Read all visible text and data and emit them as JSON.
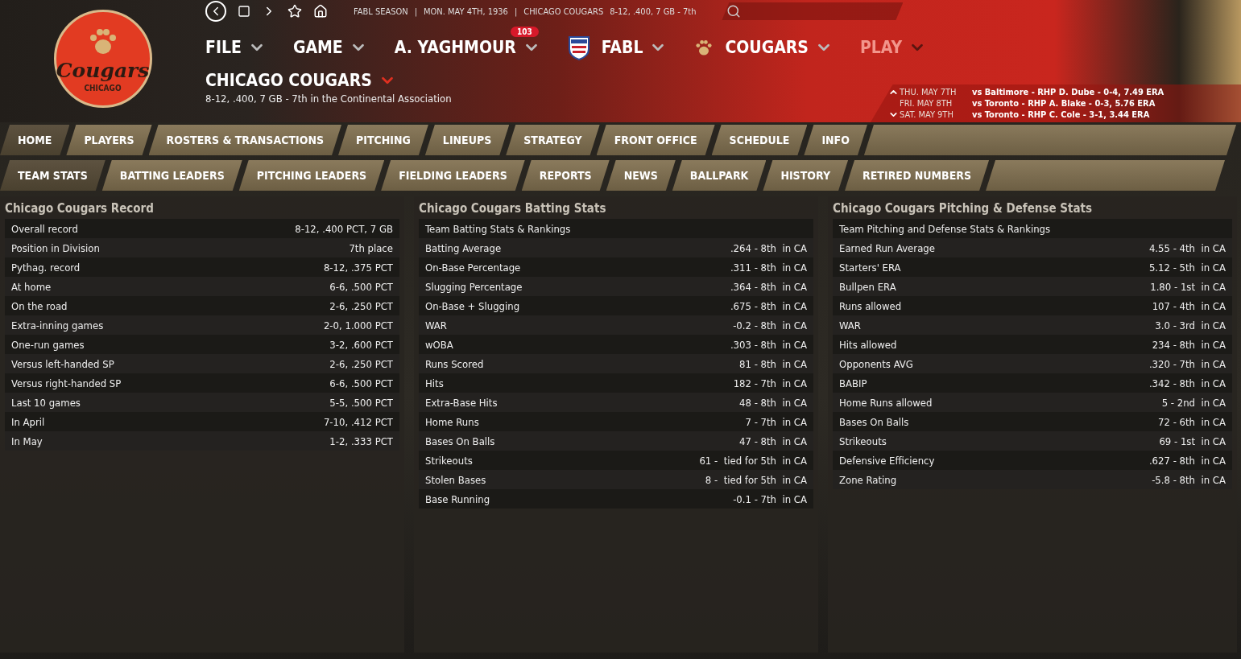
{
  "logo": {
    "name": "Cougars",
    "city": "CHICAGO"
  },
  "toolbar": {
    "separator": "|",
    "items": [
      "FABL SEASON",
      "MON. MAY 4TH, 1936",
      "CHICAGO COUGARS"
    ],
    "record": "8-12, .400, 7 GB - 7th"
  },
  "menus": [
    {
      "label": "FILE",
      "disabled": false,
      "kind": "plain"
    },
    {
      "label": "GAME",
      "disabled": false,
      "kind": "plain"
    },
    {
      "label": "A. YAGHMOUR",
      "disabled": false,
      "kind": "plain",
      "badge": "103"
    },
    {
      "label": "FABL",
      "disabled": false,
      "kind": "league"
    },
    {
      "label": "COUGARS",
      "disabled": false,
      "kind": "team"
    },
    {
      "label": "PLAY",
      "disabled": true,
      "kind": "plain"
    }
  ],
  "team": {
    "title": "CHICAGO COUGARS",
    "subtitle": "8-12, .400, 7 GB - 7th in the Continental Association"
  },
  "schedule": [
    {
      "date": "THU. MAY 7TH",
      "game": "vs Baltimore - RHP D. Dube - 0-4, 7.49 ERA"
    },
    {
      "date": "FRI. MAY 8TH",
      "game": "vs Toronto - RHP A. Blake - 0-3, 5.76 ERA"
    },
    {
      "date": "SAT. MAY 9TH",
      "game": "vs Toronto - RHP C. Cole - 3-1, 3.44 ERA"
    }
  ],
  "tabs": [
    {
      "label": "HOME",
      "selected": true
    },
    {
      "label": "PLAYERS",
      "selected": false
    },
    {
      "label": "ROSTERS & TRANSACTIONS",
      "selected": false
    },
    {
      "label": "PITCHING",
      "selected": false
    },
    {
      "label": "LINEUPS",
      "selected": false
    },
    {
      "label": "STRATEGY",
      "selected": false
    },
    {
      "label": "FRONT OFFICE",
      "selected": false
    },
    {
      "label": "SCHEDULE",
      "selected": false
    },
    {
      "label": "INFO",
      "selected": false
    }
  ],
  "subtabs": [
    {
      "label": "TEAM STATS",
      "selected": true
    },
    {
      "label": "BATTING LEADERS",
      "selected": false
    },
    {
      "label": "PITCHING LEADERS",
      "selected": false
    },
    {
      "label": "FIELDING LEADERS",
      "selected": false
    },
    {
      "label": "REPORTS",
      "selected": false
    },
    {
      "label": "NEWS",
      "selected": false
    },
    {
      "label": "BALLPARK",
      "selected": false
    },
    {
      "label": "HISTORY",
      "selected": false
    },
    {
      "label": "RETIRED NUMBERS",
      "selected": false
    }
  ],
  "panels": [
    {
      "title": "Chicago Cougars Record",
      "rows": [
        {
          "label": "Overall record",
          "value": "8-12, .400 PCT, 7 GB"
        },
        {
          "label": "Position in Division",
          "value": "7th place"
        },
        {
          "label": "Pythag. record",
          "value": "8-12, .375 PCT"
        },
        {
          "label": "At home",
          "value": "6-6, .500 PCT"
        },
        {
          "label": "On the road",
          "value": "2-6, .250 PCT"
        },
        {
          "label": "Extra-inning games",
          "value": "2-0, 1.000 PCT"
        },
        {
          "label": "One-run games",
          "value": "3-2, .600 PCT"
        },
        {
          "label": "Versus left-handed SP",
          "value": "2-6, .250 PCT"
        },
        {
          "label": "Versus right-handed SP",
          "value": "6-6, .500 PCT"
        },
        {
          "label": "Last 10 games",
          "value": "5-5, .500 PCT"
        },
        {
          "label": "In April",
          "value": "7-10, .412 PCT"
        },
        {
          "label": "In May",
          "value": "1-2, .333 PCT"
        }
      ]
    },
    {
      "title": "Chicago Cougars Batting Stats",
      "rows": [
        {
          "label": "Team Batting Stats & Rankings"
        },
        {
          "label": "Batting Average",
          "value": ".264 - 8th  in CA"
        },
        {
          "label": "On-Base Percentage",
          "value": ".311 - 8th  in CA"
        },
        {
          "label": "Slugging Percentage",
          "value": ".364 - 8th  in CA"
        },
        {
          "label": "On-Base + Slugging",
          "value": ".675 - 8th  in CA"
        },
        {
          "label": "WAR",
          "value": "-0.2 - 8th  in CA"
        },
        {
          "label": "wOBA",
          "value": ".303 - 8th  in CA"
        },
        {
          "label": "Runs Scored",
          "value": "81 - 8th  in CA"
        },
        {
          "label": "Hits",
          "value": "182 - 7th  in CA"
        },
        {
          "label": "Extra-Base Hits",
          "value": "48 - 8th  in CA"
        },
        {
          "label": "Home Runs",
          "value": "7 - 7th  in CA"
        },
        {
          "label": "Bases On Balls",
          "value": "47 - 8th  in CA"
        },
        {
          "label": "Strikeouts",
          "value": "61 -  tied for 5th  in CA"
        },
        {
          "label": "Stolen Bases",
          "value": "8 -  tied for 5th  in CA"
        },
        {
          "label": "Base Running",
          "value": "-0.1 - 7th  in CA"
        }
      ]
    },
    {
      "title": "Chicago Cougars Pitching & Defense Stats",
      "rows": [
        {
          "label": "Team Pitching and Defense Stats & Rankings"
        },
        {
          "label": "Earned Run Average",
          "value": "4.55 - 4th  in CA"
        },
        {
          "label": "Starters' ERA",
          "value": "5.12 - 5th  in CA"
        },
        {
          "label": "Bullpen ERA",
          "value": "1.80 - 1st  in CA"
        },
        {
          "label": "Runs allowed",
          "value": "107 - 4th  in CA"
        },
        {
          "label": "WAR",
          "value": "3.0 - 3rd  in CA"
        },
        {
          "label": "Hits allowed",
          "value": "234 - 8th  in CA"
        },
        {
          "label": "Opponents AVG",
          "value": ".320 - 7th  in CA"
        },
        {
          "label": "BABIP",
          "value": ".342 - 8th  in CA"
        },
        {
          "label": "Home Runs allowed",
          "value": "5 - 2nd  in CA"
        },
        {
          "label": "Bases On Balls",
          "value": "72 - 6th  in CA"
        },
        {
          "label": "Strikeouts",
          "value": "69 - 1st  in CA"
        },
        {
          "label": "Defensive Efficiency",
          "value": ".627 - 8th  in CA"
        },
        {
          "label": "Zone Rating",
          "value": "-5.8 - 8th  in CA"
        }
      ]
    }
  ]
}
